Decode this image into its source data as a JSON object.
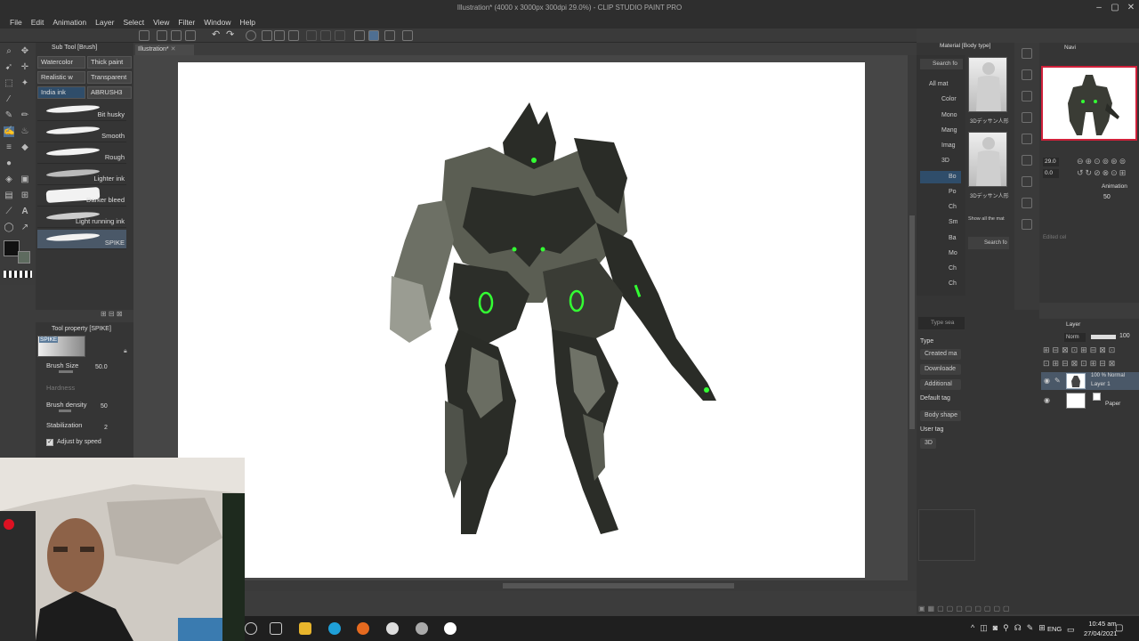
{
  "window": {
    "title": "Illustration* (4000 x 3000px 300dpi 29.0%) - CLIP STUDIO PAINT PRO"
  },
  "menu": [
    "File",
    "Edit",
    "Animation",
    "Layer",
    "Select",
    "View",
    "Filter",
    "Window",
    "Help"
  ],
  "doc_tab": "Illustration*",
  "subtool": {
    "header": "Sub Tool [Brush]",
    "tabs": [
      "Watercolor",
      "Thick paint",
      "Realistic w",
      "Transparent",
      "India ink",
      "ABRUSH3"
    ],
    "brushes": [
      "Bit husky",
      "Smooth",
      "Rough",
      "Lighter ink",
      "Darker bleed",
      "Light running ink",
      "SPIKE"
    ]
  },
  "toolprop": {
    "header": "Tool property [SPIKE]",
    "preset": "SPIKE",
    "rows": [
      {
        "label": "Brush Size",
        "value": "50.0"
      },
      {
        "label": "Hardness",
        "value": ""
      },
      {
        "label": "Brush density",
        "value": "50"
      },
      {
        "label": "Stabilization",
        "value": "2"
      }
    ],
    "adjust_label": "Adjust by speed"
  },
  "material": {
    "header": "Material [Body type]",
    "search": "Search fo",
    "tree": [
      "All mat",
      "Color",
      "Mono",
      "Mang",
      "Imag",
      "3D",
      "Bo",
      "Po",
      "Ch",
      "Sm",
      "Ba",
      "Mo",
      "Ch",
      "Ch"
    ],
    "thumb_labels": [
      "3Dデッサン人形",
      "3Dデッサン人形"
    ],
    "show_all": "Show all the mat",
    "search_bottom": "Search fo",
    "filter_search": "Type sea",
    "type_label": "Type",
    "type_filters": [
      "Created ma",
      "Downloade",
      "Additional"
    ],
    "default_tag_label": "Default tag",
    "default_tag": "Body shape",
    "user_tag_label": "User tag",
    "user_tag": "3D"
  },
  "navigator": {
    "header": "Navi",
    "zoom": "29.0",
    "rotate": "0.0",
    "animation_label": "Animation",
    "anim_value": "50",
    "edit_cel": "Edited cel"
  },
  "layers": {
    "header": "Layer",
    "blend": "Norm",
    "opacity": "100",
    "items": [
      {
        "mode": "100 % Normal",
        "name": "Layer 1"
      },
      {
        "mode": "",
        "name": "Paper"
      }
    ]
  },
  "taskbar": {
    "lang": "ENG",
    "time": "10:45 am",
    "date": "27/04/2021"
  },
  "colors": {
    "accent": "#2f4d6a",
    "nav_border": "#d0203a",
    "glow": "#33ff33"
  }
}
